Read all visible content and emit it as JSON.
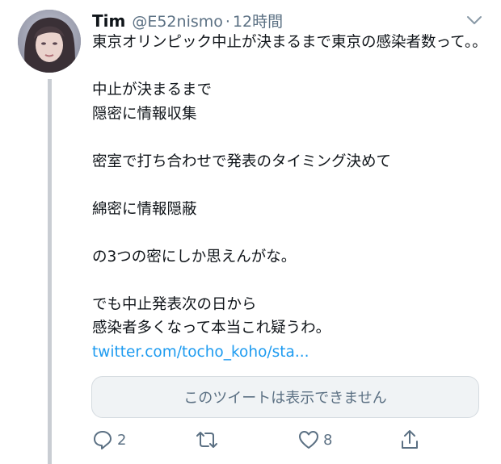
{
  "tweet": {
    "display_name": "Tim",
    "handle": "@E52nismo",
    "separator": "·",
    "time": "12時間",
    "lines": [
      "東京オリンピック中止が決まるまで東京の感染者数って。。",
      "",
      "中止が決まるまで",
      "隠密に情報収集",
      "",
      "密室で打ち合わせで発表のタイミング決めて",
      "",
      "綿密に情報隠蔽",
      "",
      "の3つの密にしか思えんがな。",
      "",
      "でも中止発表次の日から"
    ],
    "last_line_text": "感染者多くなって本当これ疑うわ。",
    "link_text": "twitter.com/tocho_koho/sta...",
    "unavailable_card_text": "このツイートは表示できません",
    "actions": {
      "reply_count": "2",
      "retweet_count": "",
      "like_count": "8"
    }
  },
  "icons": {
    "menu": "chevron-down-icon",
    "reply": "reply-icon",
    "retweet": "retweet-icon",
    "like": "heart-icon",
    "share": "share-icon"
  },
  "colors": {
    "link": "#1d9bf0",
    "muted": "#5b7083",
    "card_bg": "#f0f3f5",
    "thread_line": "#c9cdd3"
  }
}
